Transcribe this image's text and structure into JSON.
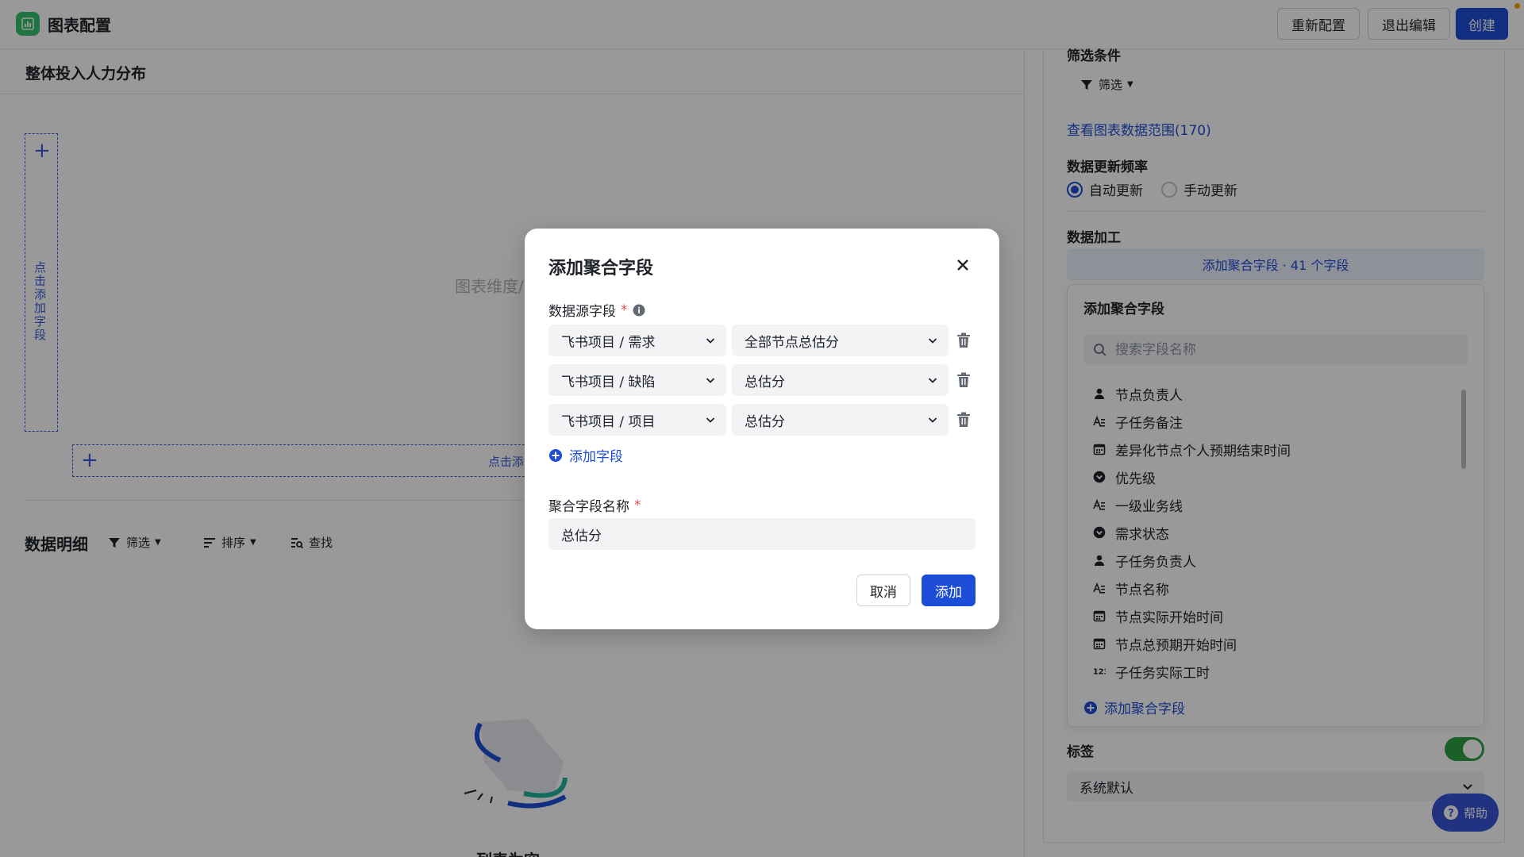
{
  "topbar": {
    "title": "图表配置",
    "reconfig_label": "重新配置",
    "exit_label": "退出编辑",
    "create_label": "创建"
  },
  "left": {
    "chart_title": "整体投入人力分布",
    "vertical_drop_text": "点击添加字段",
    "horizontal_drop_text": "点击添",
    "placeholder_text": "图表维度/",
    "detail_title": "数据明细",
    "tools": {
      "filter": "筛选",
      "sort": "排序",
      "find": "查找"
    },
    "empty_text": "列表为空"
  },
  "right": {
    "filter_section": "筛选条件",
    "filter_btn": "筛选",
    "data_range_link": "查看图表数据范围(170)",
    "update_freq_label": "数据更新频率",
    "radio_auto": "自动更新",
    "radio_manual": "手动更新",
    "processing_label": "数据加工",
    "agg_bar": "添加聚合字段 · 41 个字段",
    "panel": {
      "title": "添加聚合字段",
      "search_placeholder": "搜索字段名称",
      "items": [
        {
          "label": "节点负责人",
          "icon": "person-icon"
        },
        {
          "label": "子任务备注",
          "icon": "text-icon"
        },
        {
          "label": "差异化节点个人预期结束时间",
          "icon": "calendar-icon"
        },
        {
          "label": "优先级",
          "icon": "select-icon"
        },
        {
          "label": "一级业务线",
          "icon": "text-icon"
        },
        {
          "label": "需求状态",
          "icon": "select-icon"
        },
        {
          "label": "子任务负责人",
          "icon": "person-icon"
        },
        {
          "label": "节点名称",
          "icon": "text-icon"
        },
        {
          "label": "节点实际开始时间",
          "icon": "calendar-icon"
        },
        {
          "label": "节点总预期开始时间",
          "icon": "calendar-icon"
        },
        {
          "label": "子任务实际工时",
          "icon": "number-icon"
        }
      ],
      "add_label": "添加聚合字段"
    },
    "tag_label": "标签",
    "tag_select": "系统默认",
    "help_label": "帮助"
  },
  "modal": {
    "title": "添加聚合字段",
    "source_label": "数据源字段",
    "rows": [
      {
        "source": "飞书项目 / 需求",
        "field": "全部节点总估分"
      },
      {
        "source": "飞书项目 / 缺陷",
        "field": "总估分"
      },
      {
        "source": "飞书项目 / 项目",
        "field": "总估分"
      }
    ],
    "add_field_label": "添加字段",
    "name_label": "聚合字段名称",
    "name_value": "总估分",
    "cancel_label": "取消",
    "add_label": "添加"
  },
  "colors": {
    "primary": "#1d4dd6",
    "logo": "#34c26d",
    "toggle_on": "#2ea043",
    "required": "#e5484d"
  }
}
